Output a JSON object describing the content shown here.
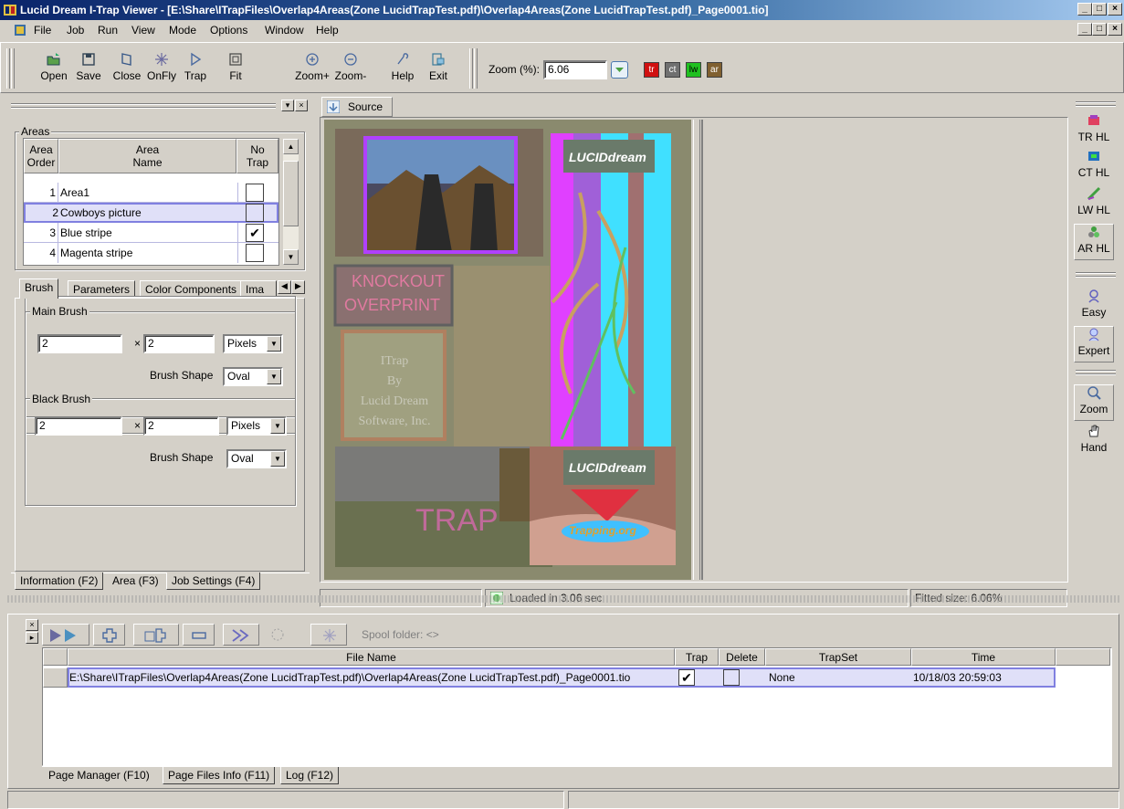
{
  "window": {
    "title": "Lucid Dream I-Trap Viewer - [E:\\Share\\ITrapFiles\\Overlap4Areas(Zone LucidTrapTest.pdf)\\Overlap4Areas(Zone LucidTrapTest.pdf)_Page0001.tio]",
    "min_label": "_",
    "max_label": "□",
    "close_label": "×"
  },
  "menu": [
    "File",
    "Job",
    "Run",
    "View",
    "Mode",
    "Options",
    "Window",
    "Help"
  ],
  "toolbar": {
    "buttons": [
      {
        "label": "Open",
        "icon": "open-icon"
      },
      {
        "label": "Save",
        "icon": "save-icon"
      },
      {
        "label": "Close",
        "icon": "close-doc-icon"
      },
      {
        "label": "OnFly",
        "icon": "onfly-icon"
      },
      {
        "label": "Trap",
        "icon": "trap-icon"
      },
      {
        "label": "Fit",
        "icon": "fit-icon"
      },
      {
        "label": "Zoom+",
        "icon": "zoom-in-icon"
      },
      {
        "label": "Zoom-",
        "icon": "zoom-out-icon"
      },
      {
        "label": "Help",
        "icon": "help-icon"
      },
      {
        "label": "Exit",
        "icon": "exit-icon"
      }
    ],
    "zoom_label": "Zoom (%):",
    "zoom_value": "6.06",
    "color_buttons": [
      {
        "label": "tr",
        "color": "#d01010"
      },
      {
        "label": "ct",
        "color": "#707070"
      },
      {
        "label": "lw",
        "color": "#20c020"
      },
      {
        "label": "ar",
        "color": "#806030"
      }
    ]
  },
  "areas": {
    "group_label": "Areas",
    "col_order": "Area Order",
    "col_order_l1": "Area",
    "col_order_l2": "Order",
    "col_name_l1": "Area",
    "col_name_l2": "Name",
    "col_notrap_l1": "No",
    "col_notrap_l2": "Trap",
    "rows": [
      {
        "order": "1",
        "name": "Area1",
        "notrap": ""
      },
      {
        "order": "2",
        "name": "Cowboys picture",
        "notrap": ""
      },
      {
        "order": "3",
        "name": "Blue stripe",
        "notrap": "✔"
      },
      {
        "order": "4",
        "name": "Magenta stripe",
        "notrap": ""
      }
    ]
  },
  "settings_tabs": [
    "Brush",
    "Parameters",
    "Color Components",
    "Ima"
  ],
  "main_brush": {
    "label": "Main Brush",
    "w": "2",
    "h": "2",
    "unit": "Pixels",
    "shape_label": "Brush Shape",
    "shape": "Oval"
  },
  "black_brush": {
    "label": "Black Brush",
    "w": "2",
    "h": "2",
    "unit": "Pixels",
    "shape_label": "Brush Shape",
    "shape": "Oval"
  },
  "times_sign": "×",
  "left_tabs": [
    "Information (F2)",
    "Area (F3)",
    "Job Settings (F4)"
  ],
  "source_tab": "Source",
  "preview_text": {
    "lucid": "LUCIDdream",
    "knockout": "KNOCKOUT",
    "overprint": "OVERPRINT",
    "itrap": [
      "ITrap",
      "By",
      "Lucid Dream",
      "Software, Inc."
    ],
    "trap": "TRAP",
    "trapping": "Trapping.org"
  },
  "center_status": {
    "loaded": "Loaded in 3.06 sec",
    "fitted": "Fitted size: 6.06%"
  },
  "right_tools": [
    {
      "label": "TR HL",
      "icon": "tr-hl-icon"
    },
    {
      "label": "CT HL",
      "icon": "ct-hl-icon"
    },
    {
      "label": "LW HL",
      "icon": "lw-hl-icon"
    },
    {
      "label": "AR HL",
      "icon": "ar-hl-icon"
    },
    {
      "label": "Easy",
      "icon": "easy-icon"
    },
    {
      "label": "Expert",
      "icon": "expert-icon"
    },
    {
      "label": "Zoom",
      "icon": "zoom-tool-icon"
    },
    {
      "label": "Hand",
      "icon": "hand-tool-icon"
    }
  ],
  "page_manager": {
    "spool_label": "Spool folder: <>",
    "columns": [
      "File Name",
      "Trap",
      "Delete",
      "TrapSet",
      "Time"
    ],
    "rows": [
      {
        "file": "E:\\Share\\ITrapFiles\\Overlap4Areas(Zone LucidTrapTest.pdf)\\Overlap4Areas(Zone LucidTrapTest.pdf)_Page0001.tio",
        "trap": "✔",
        "delete": "",
        "trapset": "None",
        "time": "10/18/03 20:59:03"
      }
    ]
  },
  "bottom_tabs": [
    "Page Manager (F10)",
    "Page Files Info (F11)",
    "Log (F12)"
  ]
}
